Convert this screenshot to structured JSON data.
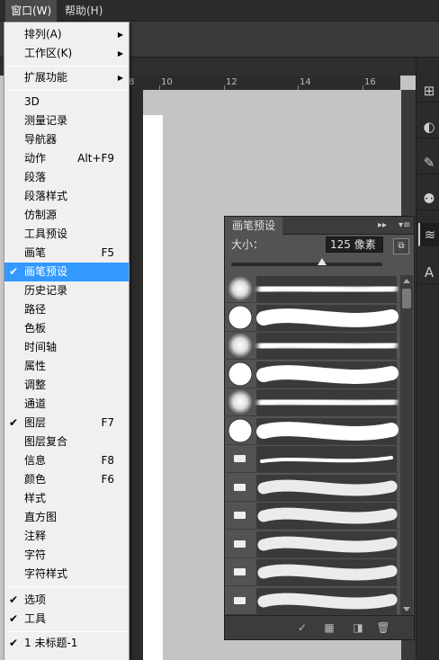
{
  "menubar": {
    "items": [
      {
        "label": "窗口(W)"
      },
      {
        "label": "帮助(H)"
      }
    ]
  },
  "ruler": {
    "ticks": [
      "8",
      "10",
      "12",
      "14",
      "16"
    ]
  },
  "window_menu": {
    "items": [
      {
        "label": "排列(A)",
        "submenu": true
      },
      {
        "label": "工作区(K)",
        "submenu": true
      },
      {
        "label": "扩展功能",
        "submenu": true
      },
      {
        "label": "3D"
      },
      {
        "label": "测量记录"
      },
      {
        "label": "导航器"
      },
      {
        "label": "动作",
        "shortcut": "Alt+F9"
      },
      {
        "label": "段落"
      },
      {
        "label": "段落样式"
      },
      {
        "label": "仿制源"
      },
      {
        "label": "工具预设"
      },
      {
        "label": "画笔",
        "shortcut": "F5"
      },
      {
        "label": "画笔预设",
        "checked": true,
        "highlighted": true
      },
      {
        "label": "历史记录"
      },
      {
        "label": "路径"
      },
      {
        "label": "色板"
      },
      {
        "label": "时间轴"
      },
      {
        "label": "属性"
      },
      {
        "label": "调整"
      },
      {
        "label": "通道"
      },
      {
        "label": "图层",
        "shortcut": "F7",
        "checked": true
      },
      {
        "label": "图层复合"
      },
      {
        "label": "信息",
        "shortcut": "F8"
      },
      {
        "label": "颜色",
        "shortcut": "F6"
      },
      {
        "label": "样式"
      },
      {
        "label": "直方图"
      },
      {
        "label": "注释"
      },
      {
        "label": "字符"
      },
      {
        "label": "字符样式"
      },
      {
        "label": "选项",
        "checked": true
      },
      {
        "label": "工具",
        "checked": true
      },
      {
        "label": "1 未标题-1",
        "checked": true
      }
    ]
  },
  "brush_panel": {
    "tab_label": "画笔预设",
    "size_label": "大小：",
    "size_value": "125 像素",
    "size_slider_fraction": 0.6,
    "presets": [
      {
        "tip": "soft-round"
      },
      {
        "tip": "hard-round"
      },
      {
        "tip": "soft-round"
      },
      {
        "tip": "hard-round"
      },
      {
        "tip": "soft-round"
      },
      {
        "tip": "hard-round"
      },
      {
        "tip": "pencil"
      },
      {
        "tip": "bristle-flat"
      },
      {
        "tip": "bristle-flat"
      },
      {
        "tip": "bristle-angle"
      },
      {
        "tip": "bristle-fan"
      },
      {
        "tip": "bristle-round"
      }
    ]
  },
  "colors": {
    "menu_highlight": "#3399ff",
    "panel_bg": "#535353",
    "canvas_bg": "#c4c4c4"
  }
}
